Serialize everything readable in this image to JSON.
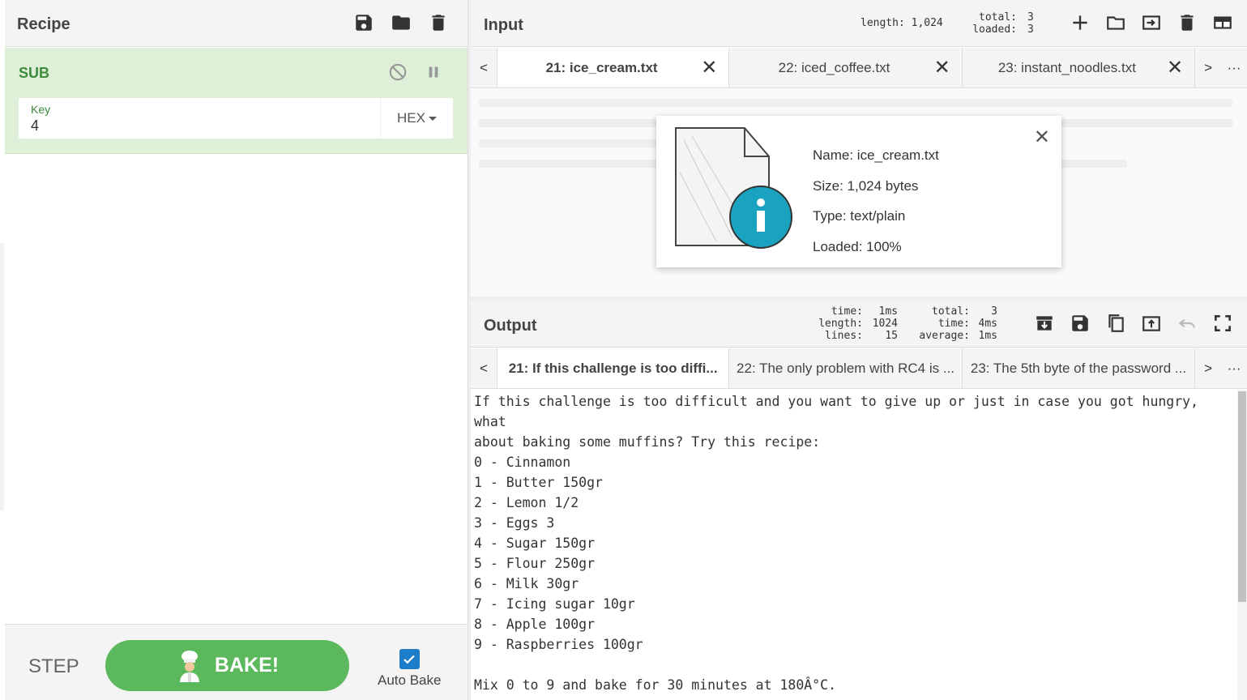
{
  "recipe": {
    "title": "Recipe",
    "operation": {
      "name": "SUB",
      "key_label": "Key",
      "key_value": "4",
      "key_type": "HEX"
    },
    "step_label": "STEP",
    "bake_label": "BAKE!",
    "auto_bake_label": "Auto Bake",
    "auto_bake_checked": true
  },
  "input": {
    "title": "Input",
    "length_stat": "length: 1,024",
    "total_label": "total:",
    "total_value": "3",
    "loaded_label": "loaded:",
    "loaded_value": "3",
    "tabs": [
      {
        "label": "21: ice_cream.txt",
        "active": true
      },
      {
        "label": "22: iced_coffee.txt",
        "active": false
      },
      {
        "label": "23: instant_noodles.txt",
        "active": false
      }
    ],
    "nav_prev": "<",
    "nav_next": ">",
    "nav_more": "···",
    "close_glyph": "✕",
    "file_info": {
      "name": "Name: ice_cream.txt",
      "size": "Size: 1,024 bytes",
      "type": "Type: text/plain",
      "loaded": "Loaded: 100%"
    }
  },
  "output": {
    "title": "Output",
    "time_label": "time:",
    "time_value": "1ms",
    "length_label": "length:",
    "length_value": "1024",
    "lines_label": "lines:",
    "lines_value": "15",
    "total_label": "total:",
    "total_value": "3",
    "time2_label": "time:",
    "time2_value": "4ms",
    "average_label": "average:",
    "average_value": "1ms",
    "tabs": [
      {
        "label": "21: If this challenge is too diffi...",
        "active": true
      },
      {
        "label": "22: The only problem with RC4 is ...",
        "active": false
      },
      {
        "label": "23: The 5th byte of the password ...",
        "active": false
      }
    ],
    "text": "If this challenge is too difficult and you want to give up or just in case you got hungry, what\nabout baking some muffins? Try this recipe:\n0 - Cinnamon\n1 - Butter 150gr\n2 - Lemon 1/2\n3 - Eggs 3\n4 - Sugar 150gr\n5 - Flour 250gr\n6 - Milk 30gr\n7 - Icing sugar 10gr\n8 - Apple 100gr\n9 - Raspberries 100gr\n\nMix 0 to 9 and bake for 30 minutes at 180Â°C."
  },
  "colors": {
    "accent_green": "#5cb85c",
    "op_bg": "#dff0d8",
    "checkbox_blue": "#1e7dc8",
    "info_teal": "#1aa3c0"
  }
}
